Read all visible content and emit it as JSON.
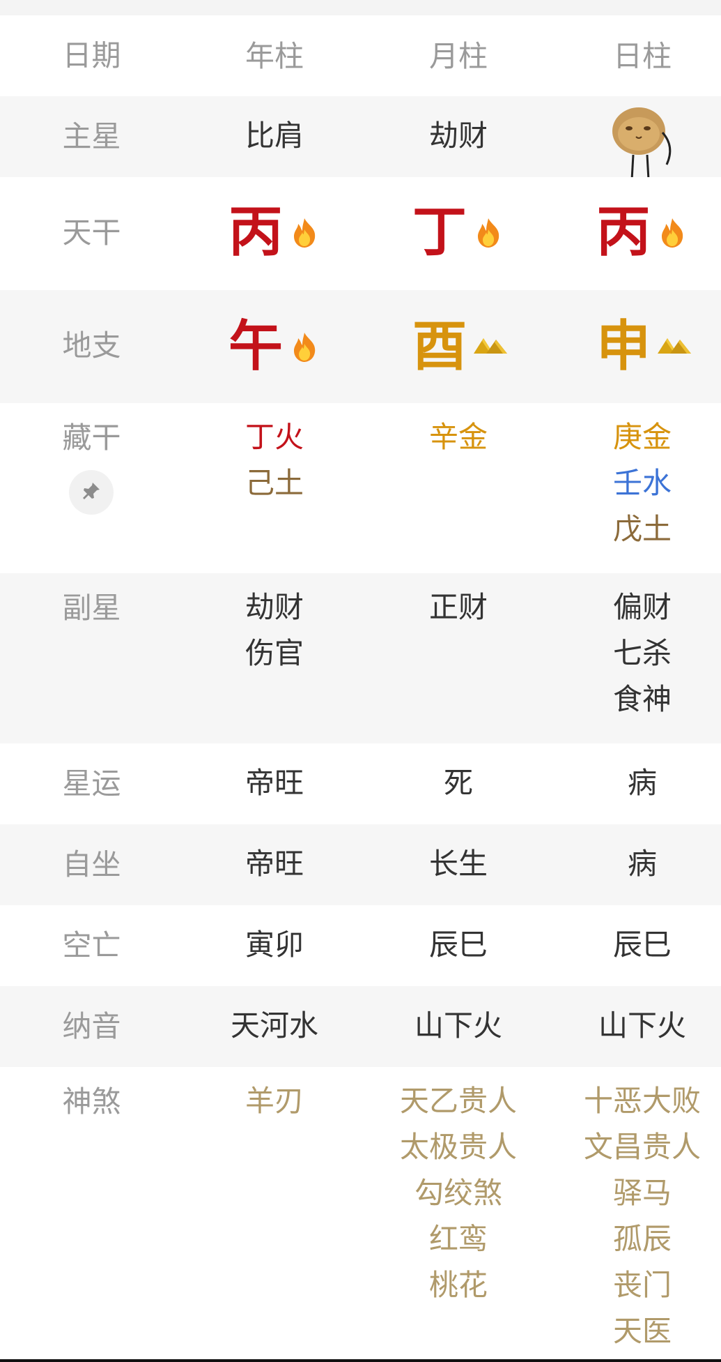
{
  "header": {
    "label": "日期",
    "col1": "年柱",
    "col2": "月柱",
    "col3": "日柱"
  },
  "zhuxing": {
    "label": "主星",
    "col1": "比肩",
    "col2": "劫财"
  },
  "tiangan": {
    "label": "天干",
    "col1": {
      "char": "丙",
      "color": "#c3121a",
      "element": "fire-icon"
    },
    "col2": {
      "char": "丁",
      "color": "#c3121a",
      "element": "fire-icon"
    },
    "col3": {
      "char": "丙",
      "color": "#c3121a",
      "element": "fire-icon"
    }
  },
  "dizhi": {
    "label": "地支",
    "col1": {
      "char": "午",
      "color": "#c3121a",
      "element": "fire-icon"
    },
    "col2": {
      "char": "酉",
      "color": "#d7930e",
      "element": "gold-ingot-icon"
    },
    "col3": {
      "char": "申",
      "color": "#d7930e",
      "element": "gold-ingot-icon"
    }
  },
  "canggan": {
    "label": "藏干",
    "col1": [
      {
        "text": "丁火",
        "color": "#c3121a"
      },
      {
        "text": "己土",
        "color": "#8b6a3a"
      }
    ],
    "col2": [
      {
        "text": "辛金",
        "color": "#d7930e"
      }
    ],
    "col3": [
      {
        "text": "庚金",
        "color": "#d7930e"
      },
      {
        "text": "壬水",
        "color": "#3c73d6"
      },
      {
        "text": "戊土",
        "color": "#8b6a3a"
      }
    ]
  },
  "fuxing": {
    "label": "副星",
    "col1": [
      "劫财",
      "伤官"
    ],
    "col2": [
      "正财"
    ],
    "col3": [
      "偏财",
      "七杀",
      "食神"
    ]
  },
  "xingyun": {
    "label": "星运",
    "col1": "帝旺",
    "col2": "死",
    "col3": "病"
  },
  "zizuo": {
    "label": "自坐",
    "col1": "帝旺",
    "col2": "长生",
    "col3": "病"
  },
  "kongwang": {
    "label": "空亡",
    "col1": "寅卯",
    "col2": "辰巳",
    "col3": "辰巳"
  },
  "nayin": {
    "label": "纳音",
    "col1": "天河水",
    "col2": "山下火",
    "col3": "山下火"
  },
  "shensha": {
    "label": "神煞",
    "color": "#b09a6a",
    "col1": [
      "羊刃"
    ],
    "col2": [
      "天乙贵人",
      "太极贵人",
      "勾绞煞",
      "红鸾",
      "桃花"
    ],
    "col3": [
      "十恶大败",
      "文昌贵人",
      "驿马",
      "孤辰",
      "丧门",
      "天医"
    ]
  }
}
